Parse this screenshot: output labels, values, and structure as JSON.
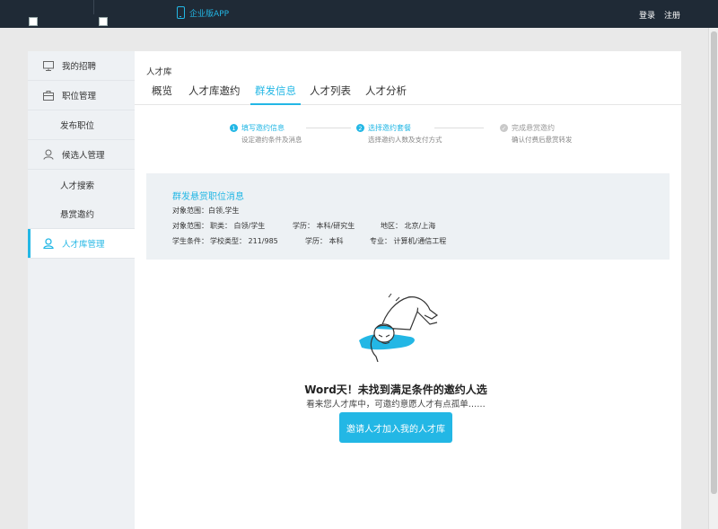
{
  "topbar": {
    "app_link": "企业版APP",
    "login": "登录",
    "register": "注册"
  },
  "sidebar": {
    "items": [
      {
        "label": "我的招聘",
        "icon": "monitor-icon"
      },
      {
        "label": "职位管理",
        "icon": "briefcase-icon"
      },
      {
        "label": "发布职位"
      },
      {
        "label": "候选人管理",
        "icon": "user-icon"
      },
      {
        "label": "人才搜索"
      },
      {
        "label": "悬赏邀约"
      },
      {
        "label": "人才库管理",
        "icon": "user-icon"
      }
    ]
  },
  "main": {
    "breadcrumb": "人才库",
    "tabs": [
      "概览",
      "人才库邀约",
      "群发信息",
      "人才列表",
      "人才分析"
    ],
    "active_tab": 2
  },
  "steps": [
    {
      "num": "1",
      "title": "填写邀约信息",
      "subtitle": "设定邀约条件及消息"
    },
    {
      "num": "2",
      "title": "选择邀约套餐",
      "subtitle": "选择邀约人数及支付方式"
    },
    {
      "num": "✓",
      "title": "完成悬赏邀约",
      "subtitle": "确认付费后悬赏转发"
    }
  ],
  "info": {
    "title": "群发悬赏职位消息",
    "row1": "对象范围：白领,学生",
    "row2": {
      "prefix": "对象范围：",
      "type": "职类： 白领/学生",
      "edu": "学历： 本科/研究生",
      "region": "地区： 北京/上海"
    },
    "row3": {
      "prefix": "学生条件：",
      "school": "学校类型： 211/985",
      "edu": "学历： 本科",
      "major": "专业： 计算机/通信工程"
    }
  },
  "empty": {
    "title": "Word天！未找到满足条件的邀约人选",
    "subtitle": "看来您人才库中，可邀约意愿人才有点孤单……",
    "button": "邀请人才加入我的人才库"
  },
  "colors": {
    "accent": "#23b7e5",
    "topbar": "#1f2a36",
    "sidebar": "#eef1f4",
    "info_bg": "#edf1f4"
  }
}
